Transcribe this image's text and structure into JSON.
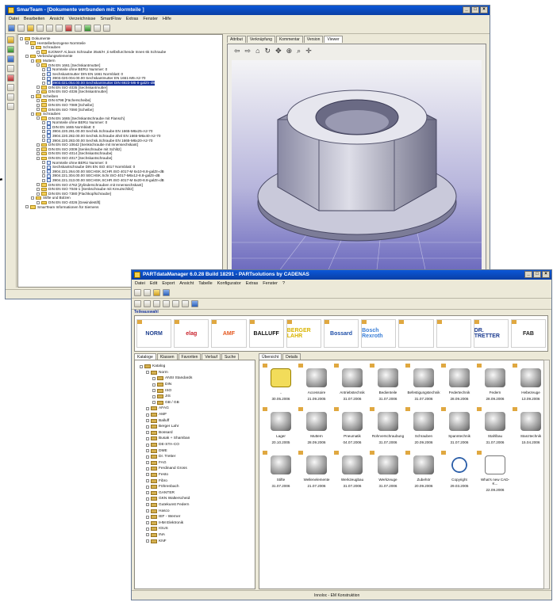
{
  "main_window": {
    "title": "SmarTeam - [Dokumente verbunden mit: Normteile ]",
    "menu": [
      "Datei",
      "Bearbeiten",
      "Ansicht",
      "Verzeichnisse",
      "SmartFlow",
      "Extras",
      "Fenster",
      "Hilfe"
    ],
    "tabs": [
      "Attribut",
      "Verknüpfung",
      "Kommentar",
      "Version",
      "Viewer"
    ],
    "active_tab": "Viewer",
    "tree": [
      {
        "label": "Dokumente",
        "level": 0
      },
      {
        "label": "Herstellerbezogene Normteile",
        "level": 1
      },
      {
        "label": "Schrauben",
        "level": 2
      },
      {
        "label": "EJOMAT Ai,bacs Schraube 35x6/H ,ti selbsfurchende Innen 6k Schraube",
        "level": 3
      },
      {
        "label": "Verbindungselemente",
        "level": 1
      },
      {
        "label": "Muttern",
        "level": 2
      },
      {
        "label": "DIN EN 1661 [Sechskantmutter]",
        "level": 3
      },
      {
        "label": "Normteile ohne BERU Nummer: 0",
        "level": 4
      },
      {
        "label": "Sechskantmutter DIN EN 1661 Normblatt: 0",
        "level": 4
      },
      {
        "label": "3903.020.004.00.00 Sechskantmutter EN 1661-M6-A2-70",
        "level": 4
      },
      {
        "label": "3903.021.054.00.00 Sechskantmutter DIN 6923-M6-8-galZn-dB",
        "level": 4,
        "selected": true
      },
      {
        "label": "DIN EN ISO 4035 [Sechskantmutter]",
        "level": 3
      },
      {
        "label": "DIN EN ISO 4036 [Sechskantmutter]",
        "level": 3
      },
      {
        "label": "Scheiben",
        "level": 2
      },
      {
        "label": "DIN 6798 [Fächerscheibe]",
        "level": 3
      },
      {
        "label": "DIN EN ISO 7089 [Scheibe]",
        "level": 3
      },
      {
        "label": "DIN EN ISO 7090 [Scheibe]",
        "level": 3
      },
      {
        "label": "Schrauben",
        "level": 2
      },
      {
        "label": "DIN EN 1665 [Sechskantschraube mit Flansch]",
        "level": 3
      },
      {
        "label": "Normteile ohne BERU Nummer: 0",
        "level": 4
      },
      {
        "label": "DIN EN 1665 Normblatt: 0",
        "level": 4
      },
      {
        "label": "3904.220.281.00.00 Sechsk.Schraube EN 1665-M6x25-A2-70",
        "level": 4
      },
      {
        "label": "3904.220.282.00.00 Sechsk.Schraube ähnl EN 1665-M6x40-A2-70",
        "level": 4
      },
      {
        "label": "3904.220.283.00.00 Sechsk.Schraube EN 1665-M6x20-A2-70",
        "level": 4
      },
      {
        "label": "DIN EN ISO 10642 [Senkschraube mit Innensechskant]",
        "level": 3
      },
      {
        "label": "DIN EN ISO 2009 [Senkschraube mit Schlitz]",
        "level": 3
      },
      {
        "label": "DIN EN ISO 4014 [Sechskantschraube]",
        "level": 3
      },
      {
        "label": "DIN EN ISO 4017 [Sechskantschraube]",
        "level": 3
      },
      {
        "label": "Normteile ohne BERU Nummer: 0",
        "level": 4
      },
      {
        "label": "Sechskantschraube DIN EN ISO 4017 Normblatt: 0",
        "level": 4
      },
      {
        "label": "3904.221.264.00.00 SECHSK.SCHR.ISO 4017-M 6x10-8.8-galZn-dB",
        "level": 4
      },
      {
        "label": "3904.221.304.00.00 SECHSK.Schr.ISO 4017-M6x12-8.8-galZn-dB",
        "level": 4
      },
      {
        "label": "3904.221.313.00.00 SECHSK.SCHR.ISO 4017-M 6x20-8.8-galZn-dB",
        "level": 4
      },
      {
        "label": "DIN EN ISO 4762 [Zylinderschrauben mit Innensechskant]",
        "level": 3
      },
      {
        "label": "DIN EN ISO 7046-1 [Senkschraube mit Kreuzschlitz]",
        "level": 3
      },
      {
        "label": "DIN EN ISO 7380 [Flachkopfschraube]",
        "level": 3
      },
      {
        "label": "Stifte und Bolzen",
        "level": 2
      },
      {
        "label": "DIN EN ISO 4026 [Gewindestift]",
        "level": 3
      },
      {
        "label": "SmarTeam Informationen für Siemens",
        "level": 1
      }
    ],
    "status": ""
  },
  "catalog_window": {
    "title": "PARTdataManager 6.0.28 Build 18291 - PARTsolutions by CADENAS",
    "menu": [
      "Datei",
      "Edit",
      "Export",
      "Ansicht",
      "Tabelle",
      "Konfigurator",
      "Extras",
      "Fenster",
      "?"
    ],
    "subtitle": "Teileauswahl",
    "logos": [
      "NORM",
      "elag",
      "AMF",
      "BALLUFF",
      "BERGER LAHR",
      "Bossard",
      "Bosch Rexroth",
      "",
      "",
      "DR. TRETTER",
      "FAB"
    ],
    "tabs": [
      "Kataloge",
      "Klassen",
      "Favoriten",
      "Verlauf",
      "Suche"
    ],
    "active_tab": "Kataloge",
    "view_tabs": [
      "Übersicht",
      "Details"
    ],
    "tree": [
      "Katalog",
      "Norm",
      "ANSI Standards",
      "DIN",
      "ISO",
      "JIS",
      "GB / GB",
      "AFAG",
      "AMF",
      "Balluff",
      "Berger Lahr",
      "Bossard",
      "Busak + Shamban",
      "DE-STA-CO",
      "DME",
      "Dr. Tretter",
      "FAG",
      "Ferdinand Gross",
      "Festo",
      "Fibro",
      "Föhrenbach",
      "GANTER",
      "GKN Walterscheid",
      "Gutekunst Federn",
      "Hasco",
      "IEF - Werner",
      "IHM Elektronik",
      "IGUS",
      "INA",
      "KNF"
    ],
    "items": [
      {
        "label": "..",
        "date": "30.05.2006",
        "type": "yel"
      },
      {
        "label": "Accessoire",
        "date": "21.09.2005",
        "type": ""
      },
      {
        "label": "Antriebstechnik",
        "date": "31.07.2006",
        "type": ""
      },
      {
        "label": "Bedienteile",
        "date": "31.07.2006",
        "type": ""
      },
      {
        "label": "Befestigungstechnik",
        "date": "31.07.2006",
        "type": ""
      },
      {
        "label": "Federtechnik",
        "date": "28.09.2006",
        "type": ""
      },
      {
        "label": "Federn",
        "date": "28.09.2006",
        "type": ""
      },
      {
        "label": "Hebezeuge",
        "date": "13.09.2006",
        "type": ""
      },
      {
        "label": "Lager",
        "date": "20.10.2005",
        "type": ""
      },
      {
        "label": "Muttern",
        "date": "28.09.2006",
        "type": ""
      },
      {
        "label": "Pneumatik",
        "date": "04.07.2006",
        "type": ""
      },
      {
        "label": "Rohrverschraubung",
        "date": "31.07.2006",
        "type": ""
      },
      {
        "label": "Schrauben",
        "date": "20.09.2006",
        "type": ""
      },
      {
        "label": "Spanntechnik",
        "date": "31.07.2006",
        "type": ""
      },
      {
        "label": "Stahlbau",
        "date": "31.07.2006",
        "type": ""
      },
      {
        "label": "Stanztechnik",
        "date": "15.04.2006",
        "type": ""
      },
      {
        "label": "Stifte",
        "date": "31.07.2006",
        "type": ""
      },
      {
        "label": "Wellenelemente",
        "date": "21.07.2006",
        "type": ""
      },
      {
        "label": "Werkzeugbau",
        "date": "31.07.2006",
        "type": ""
      },
      {
        "label": "Werkzeuge",
        "date": "31.07.2006",
        "type": ""
      },
      {
        "label": "Zubehör",
        "date": "20.09.2006",
        "type": ""
      },
      {
        "label": "Copyright",
        "date": "29.03.2005",
        "type": "cp"
      },
      {
        "label": "What's new CAD-K...",
        "date": "22.09.2006",
        "type": "pdf"
      }
    ],
    "status": "Innoloc - EM Konstruktion"
  }
}
